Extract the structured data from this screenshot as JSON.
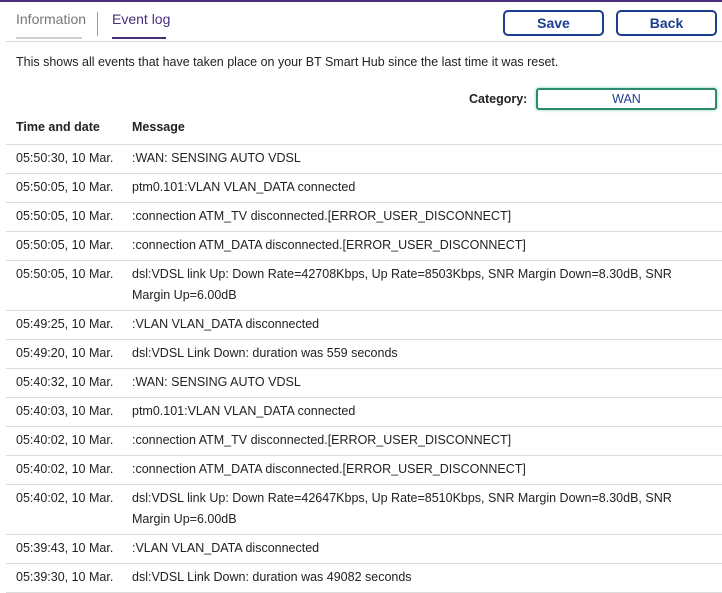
{
  "tabs": [
    {
      "label": "Information"
    },
    {
      "label": "Event log"
    }
  ],
  "buttons": {
    "save": "Save",
    "back": "Back"
  },
  "intro": "This shows all events that have taken place on your BT Smart Hub since the last time it was reset.",
  "category": {
    "label": "Category:",
    "selected": "WAN"
  },
  "table": {
    "headers": {
      "time": "Time and date",
      "message": "Message"
    },
    "rows": [
      {
        "time": "05:50:30, 10 Mar.",
        "message": ":WAN: SENSING AUTO VDSL"
      },
      {
        "time": "05:50:05, 10 Mar.",
        "message": "ptm0.101:VLAN VLAN_DATA connected"
      },
      {
        "time": "05:50:05, 10 Mar.",
        "message": ":connection ATM_TV disconnected.[ERROR_USER_DISCONNECT]"
      },
      {
        "time": "05:50:05, 10 Mar.",
        "message": ":connection ATM_DATA disconnected.[ERROR_USER_DISCONNECT]"
      },
      {
        "time": "05:50:05, 10 Mar.",
        "message": "dsl:VDSL link Up: Down Rate=42708Kbps, Up Rate=8503Kbps, SNR Margin Down=8.30dB, SNR Margin Up=6.00dB"
      },
      {
        "time": "05:49:25, 10 Mar.",
        "message": ":VLAN VLAN_DATA disconnected"
      },
      {
        "time": "05:49:20, 10 Mar.",
        "message": "dsl:VDSL Link Down: duration was 559 seconds"
      },
      {
        "time": "05:40:32, 10 Mar.",
        "message": ":WAN: SENSING AUTO VDSL"
      },
      {
        "time": "05:40:03, 10 Mar.",
        "message": "ptm0.101:VLAN VLAN_DATA connected"
      },
      {
        "time": "05:40:02, 10 Mar.",
        "message": ":connection ATM_TV disconnected.[ERROR_USER_DISCONNECT]"
      },
      {
        "time": "05:40:02, 10 Mar.",
        "message": ":connection ATM_DATA disconnected.[ERROR_USER_DISCONNECT]"
      },
      {
        "time": "05:40:02, 10 Mar.",
        "message": "dsl:VDSL link Up: Down Rate=42647Kbps, Up Rate=8510Kbps, SNR Margin Down=8.30dB, SNR Margin Up=6.00dB"
      },
      {
        "time": "05:39:43, 10 Mar.",
        "message": ":VLAN VLAN_DATA disconnected"
      },
      {
        "time": "05:39:30, 10 Mar.",
        "message": "dsl:VDSL Link Down: duration was 49082 seconds"
      }
    ]
  },
  "colors": {
    "accent": "#4a2d7a",
    "button": "#1a3e8c",
    "select_border": "#2e8a6f"
  }
}
